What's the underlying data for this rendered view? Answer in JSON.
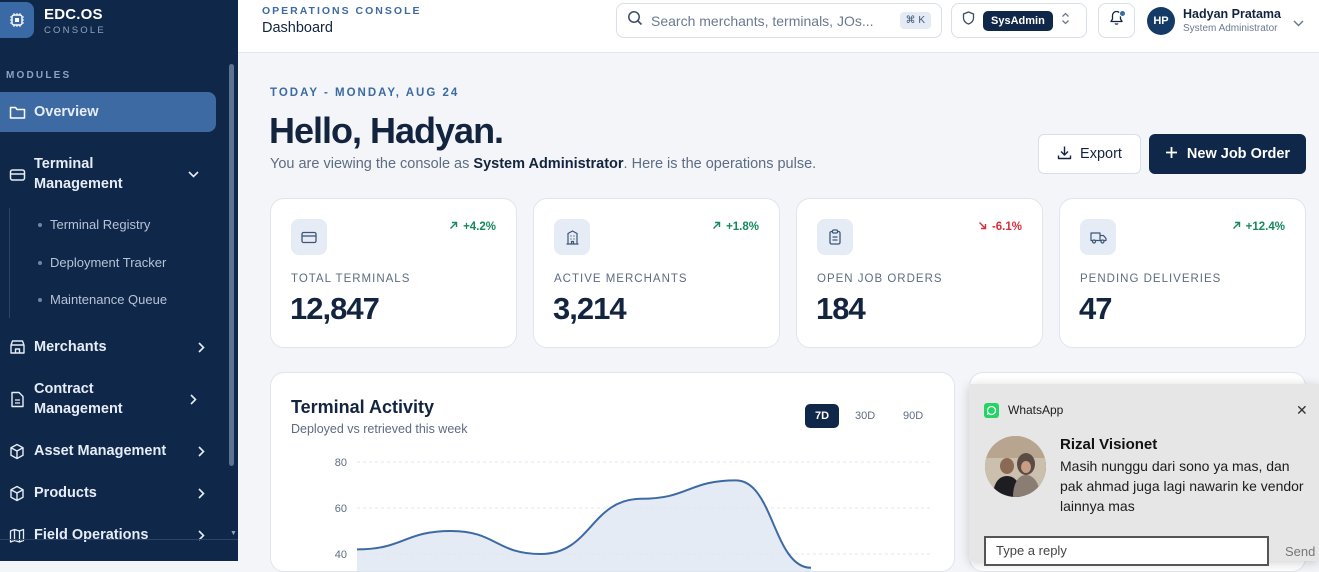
{
  "brand": {
    "title": "EDC.OS",
    "subtitle": "CONSOLE"
  },
  "sidebar": {
    "section_label": "MODULES",
    "items": [
      {
        "label": "Overview",
        "icon": "folder-icon",
        "active": true
      },
      {
        "label": "Terminal Management",
        "icon": "terminal-icon",
        "expanded": true,
        "children": [
          "Terminal Registry",
          "Deployment Tracker",
          "Maintenance Queue"
        ]
      },
      {
        "label": "Merchants",
        "icon": "store-icon"
      },
      {
        "label": "Contract Management",
        "icon": "document-icon"
      },
      {
        "label": "Asset Management",
        "icon": "box-icon"
      },
      {
        "label": "Products",
        "icon": "package-icon"
      },
      {
        "label": "Field Operations",
        "icon": "map-icon"
      }
    ]
  },
  "topbar": {
    "crumb_section": "OPERATIONS CONSOLE",
    "crumb_page": "Dashboard",
    "search_placeholder": "Search merchants, terminals, JOs...",
    "search_shortcut": "⌘ K",
    "role_badge": "SysAdmin",
    "user_initials": "HP",
    "user_name": "Hadyan Pratama",
    "user_role": "System Administrator"
  },
  "header": {
    "date_line": "TODAY - MONDAY, AUG 24",
    "greeting": "Hello, Hadyan.",
    "subtitle_prefix": "You are viewing the console as ",
    "subtitle_role": "System Administrator",
    "subtitle_suffix": ". Here is the operations pulse.",
    "export_label": "Export",
    "new_job_label": "New Job Order"
  },
  "stats": [
    {
      "label": "TOTAL TERMINALS",
      "value": "12,847",
      "change": "+4.2%",
      "trend": "up",
      "icon": "card-icon"
    },
    {
      "label": "ACTIVE MERCHANTS",
      "value": "3,214",
      "change": "+1.8%",
      "trend": "up",
      "icon": "building-icon"
    },
    {
      "label": "OPEN JOB ORDERS",
      "value": "184",
      "change": "-6.1%",
      "trend": "down",
      "icon": "clipboard-icon"
    },
    {
      "label": "PENDING DELIVERIES",
      "value": "47",
      "change": "+12.4%",
      "trend": "up",
      "icon": "truck-icon"
    }
  ],
  "colors": {
    "up": "#16895a",
    "down": "#d92d3a",
    "accent": "#3e6aa4",
    "navy": "#0f2748"
  },
  "activity": {
    "title": "Terminal Activity",
    "subtitle": "Deployed vs retrieved this week",
    "ranges": [
      "7D",
      "30D",
      "90D"
    ],
    "selected_range": "7D"
  },
  "chart_data": {
    "type": "area",
    "title": "Terminal Activity",
    "y_ticks": [
      "80",
      "60",
      "40"
    ],
    "ylim": [
      40,
      80
    ],
    "grid": true,
    "series": [
      {
        "values": [
          42,
          50,
          40,
          64,
          72,
          34
        ]
      }
    ]
  },
  "notification": {
    "app": "WhatsApp",
    "sender": "Rizal Visionet",
    "message": "Masih nunggu dari sono ya mas, dan pak ahmad juga lagi nawarin ke vendor lainnya mas",
    "reply_placeholder": "Type a reply",
    "send_label": "Send"
  }
}
